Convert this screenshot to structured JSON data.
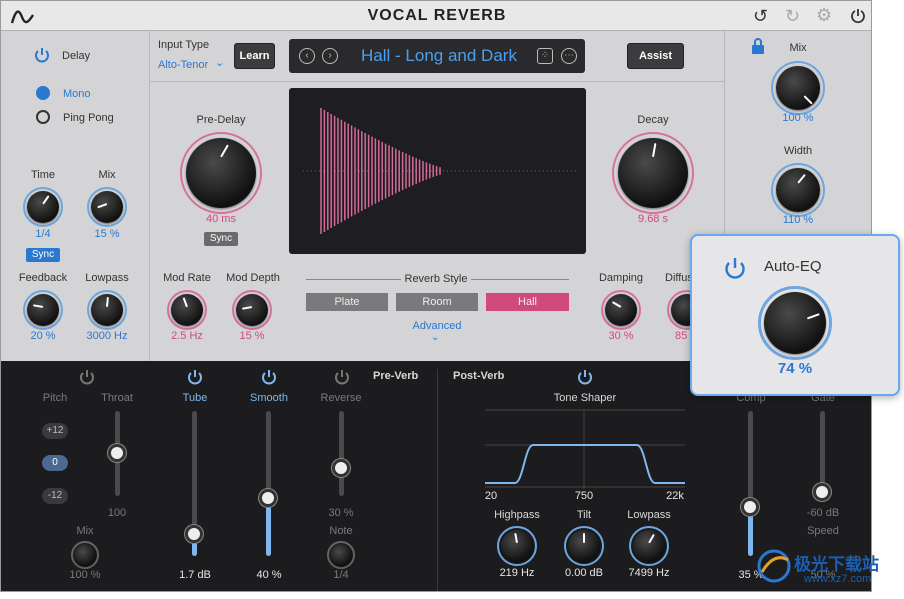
{
  "app": {
    "title": "VOCAL REVERB"
  },
  "delay": {
    "label": "Delay",
    "modes": [
      "Mono",
      "Ping Pong"
    ],
    "time": {
      "label": "Time",
      "value": "1/4",
      "sync": "Sync"
    },
    "mix": {
      "label": "Mix",
      "value": "15 %"
    },
    "feedback": {
      "label": "Feedback",
      "value": "20 %"
    },
    "lowpass": {
      "label": "Lowpass",
      "value": "3000 Hz"
    }
  },
  "input": {
    "label": "Input Type",
    "value": "Alto-Tenor",
    "learn": "Learn"
  },
  "preset": {
    "name": "Hall - Long and Dark"
  },
  "assist": "Assist",
  "predelay": {
    "label": "Pre-Delay",
    "value": "40 ms",
    "sync": "Sync"
  },
  "decay": {
    "label": "Decay",
    "value": "9.68 s"
  },
  "modrate": {
    "label": "Mod Rate",
    "value": "2.5 Hz"
  },
  "moddepth": {
    "label": "Mod Depth",
    "value": "15 %"
  },
  "reverbstyle": {
    "label": "Reverb Style",
    "options": [
      "Plate",
      "Room",
      "Hall"
    ],
    "advanced": "Advanced"
  },
  "damping": {
    "label": "Damping",
    "value": "30 %"
  },
  "diffusion": {
    "label": "Diffus",
    "value": "85"
  },
  "right": {
    "mix": {
      "label": "Mix",
      "value": "100 %"
    },
    "width": {
      "label": "Width",
      "value": "110 %"
    }
  },
  "autoeq": {
    "label": "Auto-EQ",
    "value": "74 %"
  },
  "preverb": {
    "title": "Pre-Verb",
    "pitch": {
      "label": "Pitch",
      "options": [
        "+12",
        "0",
        "-12"
      ],
      "mix_label": "Mix",
      "mix_value": "100 %"
    },
    "throat": {
      "label": "Throat",
      "value": "100"
    },
    "tube": {
      "label": "Tube",
      "value": "1.7 dB"
    },
    "smooth": {
      "label": "Smooth",
      "value": "40 %"
    },
    "reverse": {
      "label": "Reverse",
      "value": "30 %",
      "note_label": "Note",
      "note_value": "1/4"
    }
  },
  "postverb": {
    "title": "Post-Verb",
    "toneshaper": {
      "label": "Tone Shaper",
      "ticks": [
        "20",
        "750",
        "22k"
      ]
    },
    "highpass": {
      "label": "Highpass",
      "value": "219 Hz"
    },
    "tilt": {
      "label": "Tilt",
      "value": "0.00 dB"
    },
    "lowpass": {
      "label": "Lowpass",
      "value": "7499 Hz"
    },
    "comp": {
      "label": "Comp",
      "value": "35 %"
    },
    "gate": {
      "label": "Gate",
      "value": "-60 dB",
      "speed_label": "Speed",
      "speed_value": "50 %"
    }
  },
  "watermark": {
    "text": "极光下载站",
    "url": "www.xz7.com"
  },
  "colors": {
    "accent": "#2a78d0",
    "pink": "#d04a7e",
    "dark": "#1c1c1e",
    "panel": "#d4d4d6"
  }
}
